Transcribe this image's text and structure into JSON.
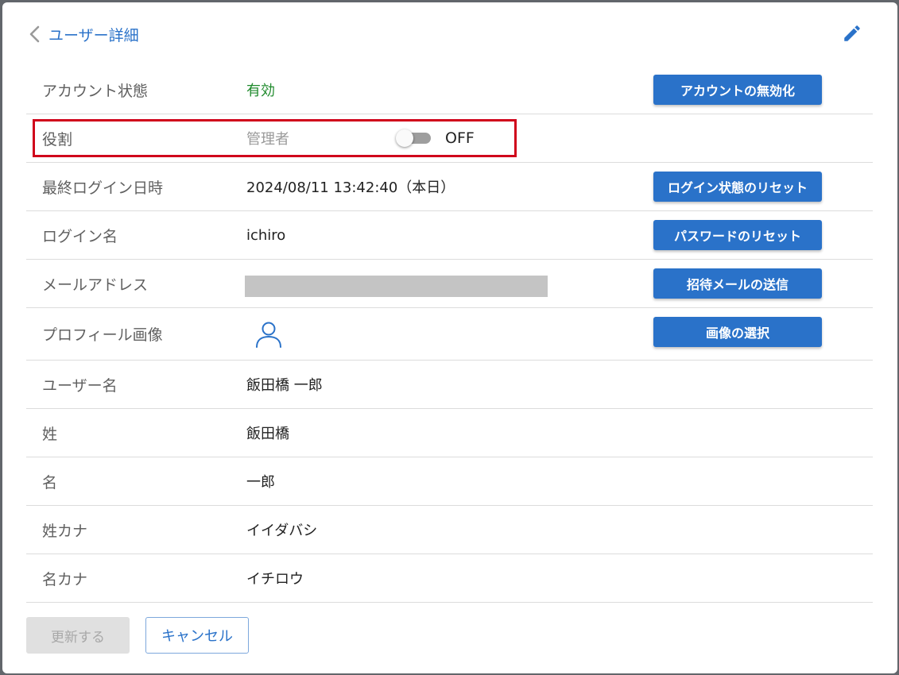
{
  "header": {
    "back_label": "ユーザー詳細"
  },
  "rows": {
    "account_status": {
      "label": "アカウント状態",
      "value": "有効",
      "action": "アカウントの無効化"
    },
    "role": {
      "label": "役割",
      "value": "管理者",
      "toggle_state": "OFF"
    },
    "last_login": {
      "label": "最終ログイン日時",
      "value": "2024/08/11 13:42:40（本日）",
      "action": "ログイン状態のリセット"
    },
    "login_name": {
      "label": "ログイン名",
      "value": "ichiro",
      "action": "パスワードのリセット"
    },
    "email": {
      "label": "メールアドレス",
      "action": "招待メールの送信"
    },
    "profile_image": {
      "label": "プロフィール画像",
      "icon": "user-icon",
      "action": "画像の選択"
    },
    "user_name": {
      "label": "ユーザー名",
      "value": "飯田橋 一郎"
    },
    "last_name": {
      "label": "姓",
      "value": "飯田橋"
    },
    "first_name": {
      "label": "名",
      "value": "一郎"
    },
    "last_name_kana": {
      "label": "姓カナ",
      "value": "イイダバシ"
    },
    "first_name_kana": {
      "label": "名カナ",
      "value": "イチロウ"
    }
  },
  "footer": {
    "update_label": "更新する",
    "cancel_label": "キャンセル"
  },
  "colors": {
    "accent": "#2a72c9",
    "status_active": "#1f8a2c",
    "highlight": "#d0021b"
  }
}
